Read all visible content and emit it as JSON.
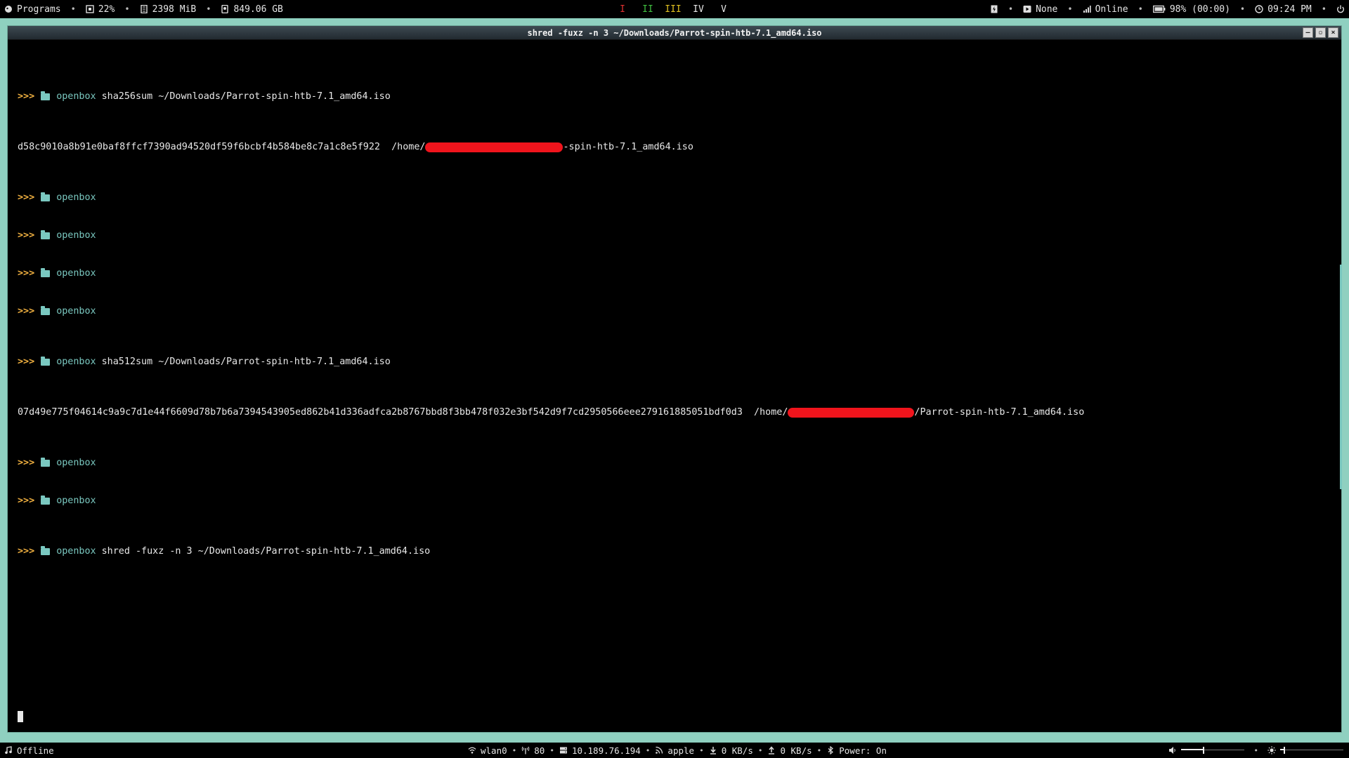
{
  "topbar": {
    "programs": "Programs",
    "cpu": "22%",
    "memory": "2398 MiB",
    "disk": "849.06 GB",
    "workspaces": [
      {
        "label": "I",
        "color": "#e03030"
      },
      {
        "label": "II",
        "color": "#40c040"
      },
      {
        "label": "III",
        "color": "#e0c020"
      },
      {
        "label": "IV",
        "color": "#e6e6e6"
      },
      {
        "label": "V",
        "color": "#e6e6e6"
      }
    ],
    "media": "None",
    "network": "Online",
    "battery": "98% (00:00)",
    "clock": "09:24 PM"
  },
  "window": {
    "title": "shred -fuxz -n 3 ~/Downloads/Parrot-spin-htb-7.1_amd64.iso",
    "buttons": [
      "–",
      "▫",
      "×"
    ]
  },
  "terminal": {
    "prompt": ">>>",
    "dir": "openbox",
    "lines": [
      {
        "type": "prompt",
        "cmd": "sha256sum ~/Downloads/Parrot-spin-htb-7.1_amd64.iso"
      },
      {
        "type": "output",
        "hash": "d58c9010a8b91e0baf8ffcf7390ad94520df59f6bcbf4b584be8c7a1c8e5f922",
        "path_prefix": "/home/",
        "path_suffix": "-spin-htb-7.1_amd64.iso"
      },
      {
        "type": "prompt",
        "cmd": ""
      },
      {
        "type": "prompt",
        "cmd": ""
      },
      {
        "type": "prompt",
        "cmd": ""
      },
      {
        "type": "prompt",
        "cmd": ""
      },
      {
        "type": "prompt",
        "cmd": "sha512sum ~/Downloads/Parrot-spin-htb-7.1_amd64.iso"
      },
      {
        "type": "output",
        "hash": "07d49e775f04614c9a9c7d1e44f6609d78b7b6a7394543905ed862b41d336adfca2b8767bbd8f3bb478f032e3bf542d9f7cd2950566eee279161885051bdf0d3",
        "path_prefix": "/home/",
        "path_suffix": "/Parrot-spin-htb-7.1_amd64.iso"
      },
      {
        "type": "prompt",
        "cmd": ""
      },
      {
        "type": "prompt",
        "cmd": ""
      },
      {
        "type": "prompt",
        "cmd": "shred -fuxz -n 3 ~/Downloads/Parrot-spin-htb-7.1_amd64.iso"
      }
    ]
  },
  "bottombar": {
    "music": "Offline",
    "interface": "wlan0",
    "signal": "80",
    "ip": "10.189.76.194",
    "ssid": "apple",
    "down": "0 KB/s",
    "up": "0 KB/s",
    "bluetooth": "Power: On",
    "volume_level": 0.35,
    "brightness_level": 0.05
  }
}
